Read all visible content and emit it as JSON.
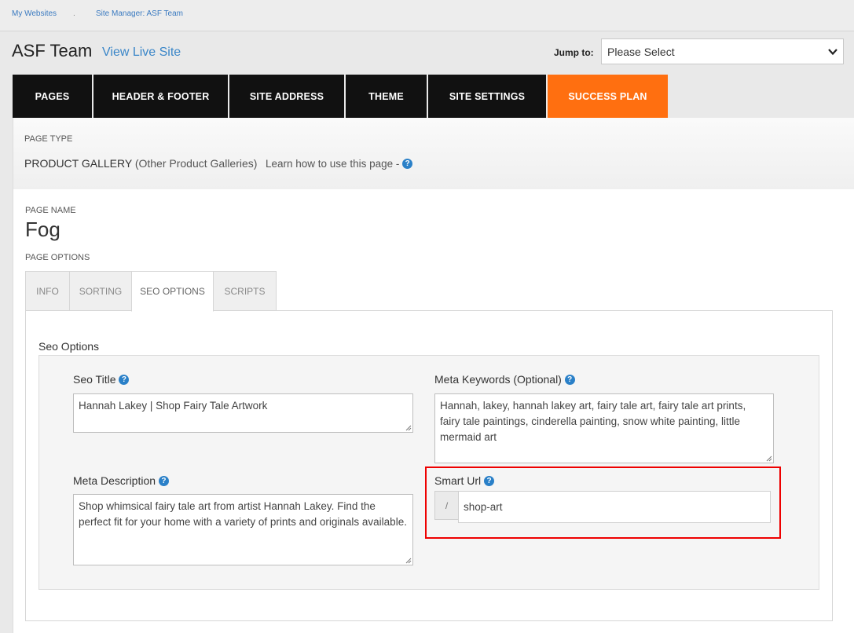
{
  "breadcrumb": {
    "home": "My Websites",
    "separator": ".",
    "current": "Site Manager: ASF Team"
  },
  "header": {
    "site_name": "ASF Team",
    "view_live": "View Live Site",
    "jump_label": "Jump to:",
    "jump_value": "Please Select"
  },
  "nav": {
    "tabs": [
      "PAGES",
      "HEADER & FOOTER",
      "SITE ADDRESS",
      "THEME",
      "SITE SETTINGS",
      "SUCCESS PLAN"
    ],
    "active_color": "#ff6f10"
  },
  "page_type": {
    "label": "PAGE TYPE",
    "value": "PRODUCT GALLERY",
    "sub": "(Other Product Galleries)",
    "learn": "Learn how to use this page -"
  },
  "page_name": {
    "label": "PAGE NAME",
    "value": "Fog"
  },
  "page_options": {
    "label": "PAGE OPTIONS",
    "tabs": [
      "INFO",
      "SORTING",
      "SEO OPTIONS",
      "SCRIPTS"
    ],
    "active_tab": "SEO OPTIONS"
  },
  "seo": {
    "heading": "Seo Options",
    "title_label": "Seo Title",
    "title_value": "Hannah Lakey | Shop Fairy Tale Artwork",
    "keywords_label": "Meta Keywords (Optional)",
    "keywords_value": "Hannah, lakey, hannah lakey art, fairy tale art, fairy tale art prints, fairy tale paintings, cinderella painting, snow white painting, little mermaid art",
    "description_label": "Meta Description",
    "description_value": "Shop whimsical fairy tale art from artist Hannah Lakey. Find the perfect fit for your home with a variety of prints and originals available.",
    "smart_url_label": "Smart Url",
    "smart_url_prefix": "/",
    "smart_url_value": "shop-art"
  },
  "icons": {
    "help": "question-circle-icon",
    "dropdown": "chevron-down-icon",
    "resize": "resize-handle-icon"
  }
}
